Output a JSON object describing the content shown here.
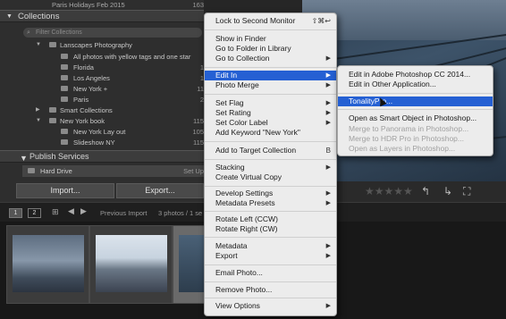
{
  "left_panel": {
    "top_row": {
      "label": "Paris Holidays Feb 2015",
      "count": "163"
    },
    "collections_header": "Collections",
    "filter_placeholder": "Filter Collections",
    "rows": [
      {
        "label": "Lanscapes Photography",
        "count": ""
      },
      {
        "label": "All photos with yellow tags and one star",
        "count": ""
      },
      {
        "label": "Florida",
        "count": "1"
      },
      {
        "label": "Los Angeles",
        "count": "1"
      },
      {
        "label": "New York +",
        "count": "11"
      },
      {
        "label": "Paris",
        "count": "2"
      },
      {
        "label": "Smart Collections",
        "count": ""
      },
      {
        "label": "New York book",
        "count": "115"
      },
      {
        "label": "New York Lay out",
        "count": "105"
      },
      {
        "label": "Slideshow NY",
        "count": "115"
      }
    ],
    "publish_header": "Publish Services",
    "hard_drive": {
      "label": "Hard Drive",
      "status": "Set Up"
    },
    "import_label": "Import...",
    "export_label": "Export..."
  },
  "filmstrip_bar": {
    "page1": "1",
    "page2": "2",
    "source": "Previous Import",
    "count_text": "3 photos / 1 se"
  },
  "context_menu": {
    "items": [
      {
        "label": "Lock to Second Monitor",
        "shortcut": "⇧⌘↩"
      },
      {
        "label": "Show in Finder"
      },
      {
        "label": "Go to Folder in Library"
      },
      {
        "label": "Go to Collection",
        "submenu": true
      },
      {
        "label": "Edit In",
        "submenu": true,
        "highlighted": true
      },
      {
        "label": "Photo Merge",
        "submenu": true
      },
      {
        "label": "Set Flag",
        "submenu": true
      },
      {
        "label": "Set Rating",
        "submenu": true
      },
      {
        "label": "Set Color Label",
        "submenu": true
      },
      {
        "label": "Add Keyword \"New York\""
      },
      {
        "label": "Add to Target Collection",
        "shortcut": "B"
      },
      {
        "label": "Stacking",
        "submenu": true
      },
      {
        "label": "Create Virtual Copy"
      },
      {
        "label": "Develop Settings",
        "submenu": true
      },
      {
        "label": "Metadata Presets",
        "submenu": true
      },
      {
        "label": "Rotate Left (CCW)"
      },
      {
        "label": "Rotate Right (CW)"
      },
      {
        "label": "Metadata",
        "submenu": true
      },
      {
        "label": "Export",
        "submenu": true
      },
      {
        "label": "Email Photo..."
      },
      {
        "label": "Remove Photo..."
      },
      {
        "label": "View Options",
        "submenu": true
      }
    ]
  },
  "submenu": {
    "items": [
      {
        "label": "Edit in Adobe Photoshop CC 2014..."
      },
      {
        "label": "Edit in Other Application..."
      },
      {
        "label": "TonalityPro...",
        "highlighted": true
      },
      {
        "label": "Open as Smart Object in Photoshop..."
      },
      {
        "label": "Merge to Panorama in Photoshop...",
        "disabled": true
      },
      {
        "label": "Merge to HDR Pro in Photoshop...",
        "disabled": true
      },
      {
        "label": "Open as Layers in Photoshop...",
        "disabled": true
      }
    ]
  },
  "colors": {
    "highlight": "#2560d3",
    "menu_bg": "#ececec"
  },
  "icons": [
    "folder-icon",
    "smart-collection-icon",
    "collection-set-icon",
    "hard-drive-icon",
    "search-icon",
    "grid-icon",
    "arrow-left-icon",
    "arrow-right-icon",
    "star-icon",
    "rotate-icon",
    "crop-icon"
  ]
}
